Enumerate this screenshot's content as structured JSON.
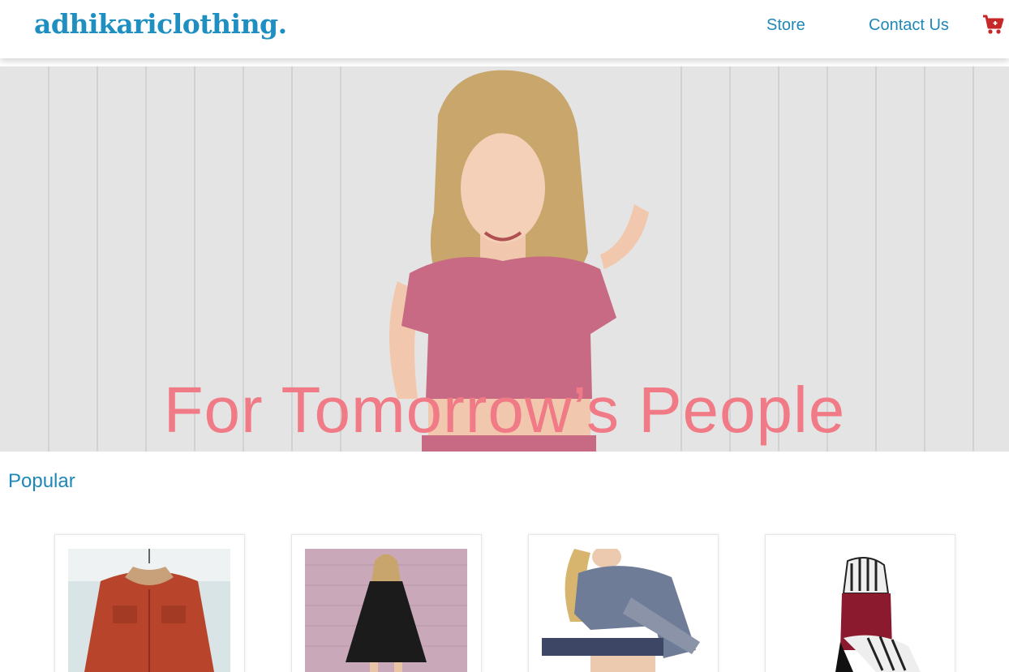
{
  "header": {
    "logo": "adhikariclothing.",
    "nav": [
      {
        "label": "Store"
      },
      {
        "label": "Contact Us"
      }
    ],
    "cart_icon": "shopping-cart-icon",
    "cart_color": "#c62828"
  },
  "hero": {
    "headline": "For Tomorrow’s People",
    "headline_color": "#f07b86"
  },
  "popular": {
    "title": "Popular",
    "products": [
      {
        "image": "red-corduroy-jacket"
      },
      {
        "image": "black-swing-dress"
      },
      {
        "image": "gray-long-sleeve-top"
      },
      {
        "image": "striped-hoodie-set"
      }
    ]
  },
  "colors": {
    "brand": "#1e88b8",
    "accent": "#f07b86",
    "cart": "#c62828"
  }
}
